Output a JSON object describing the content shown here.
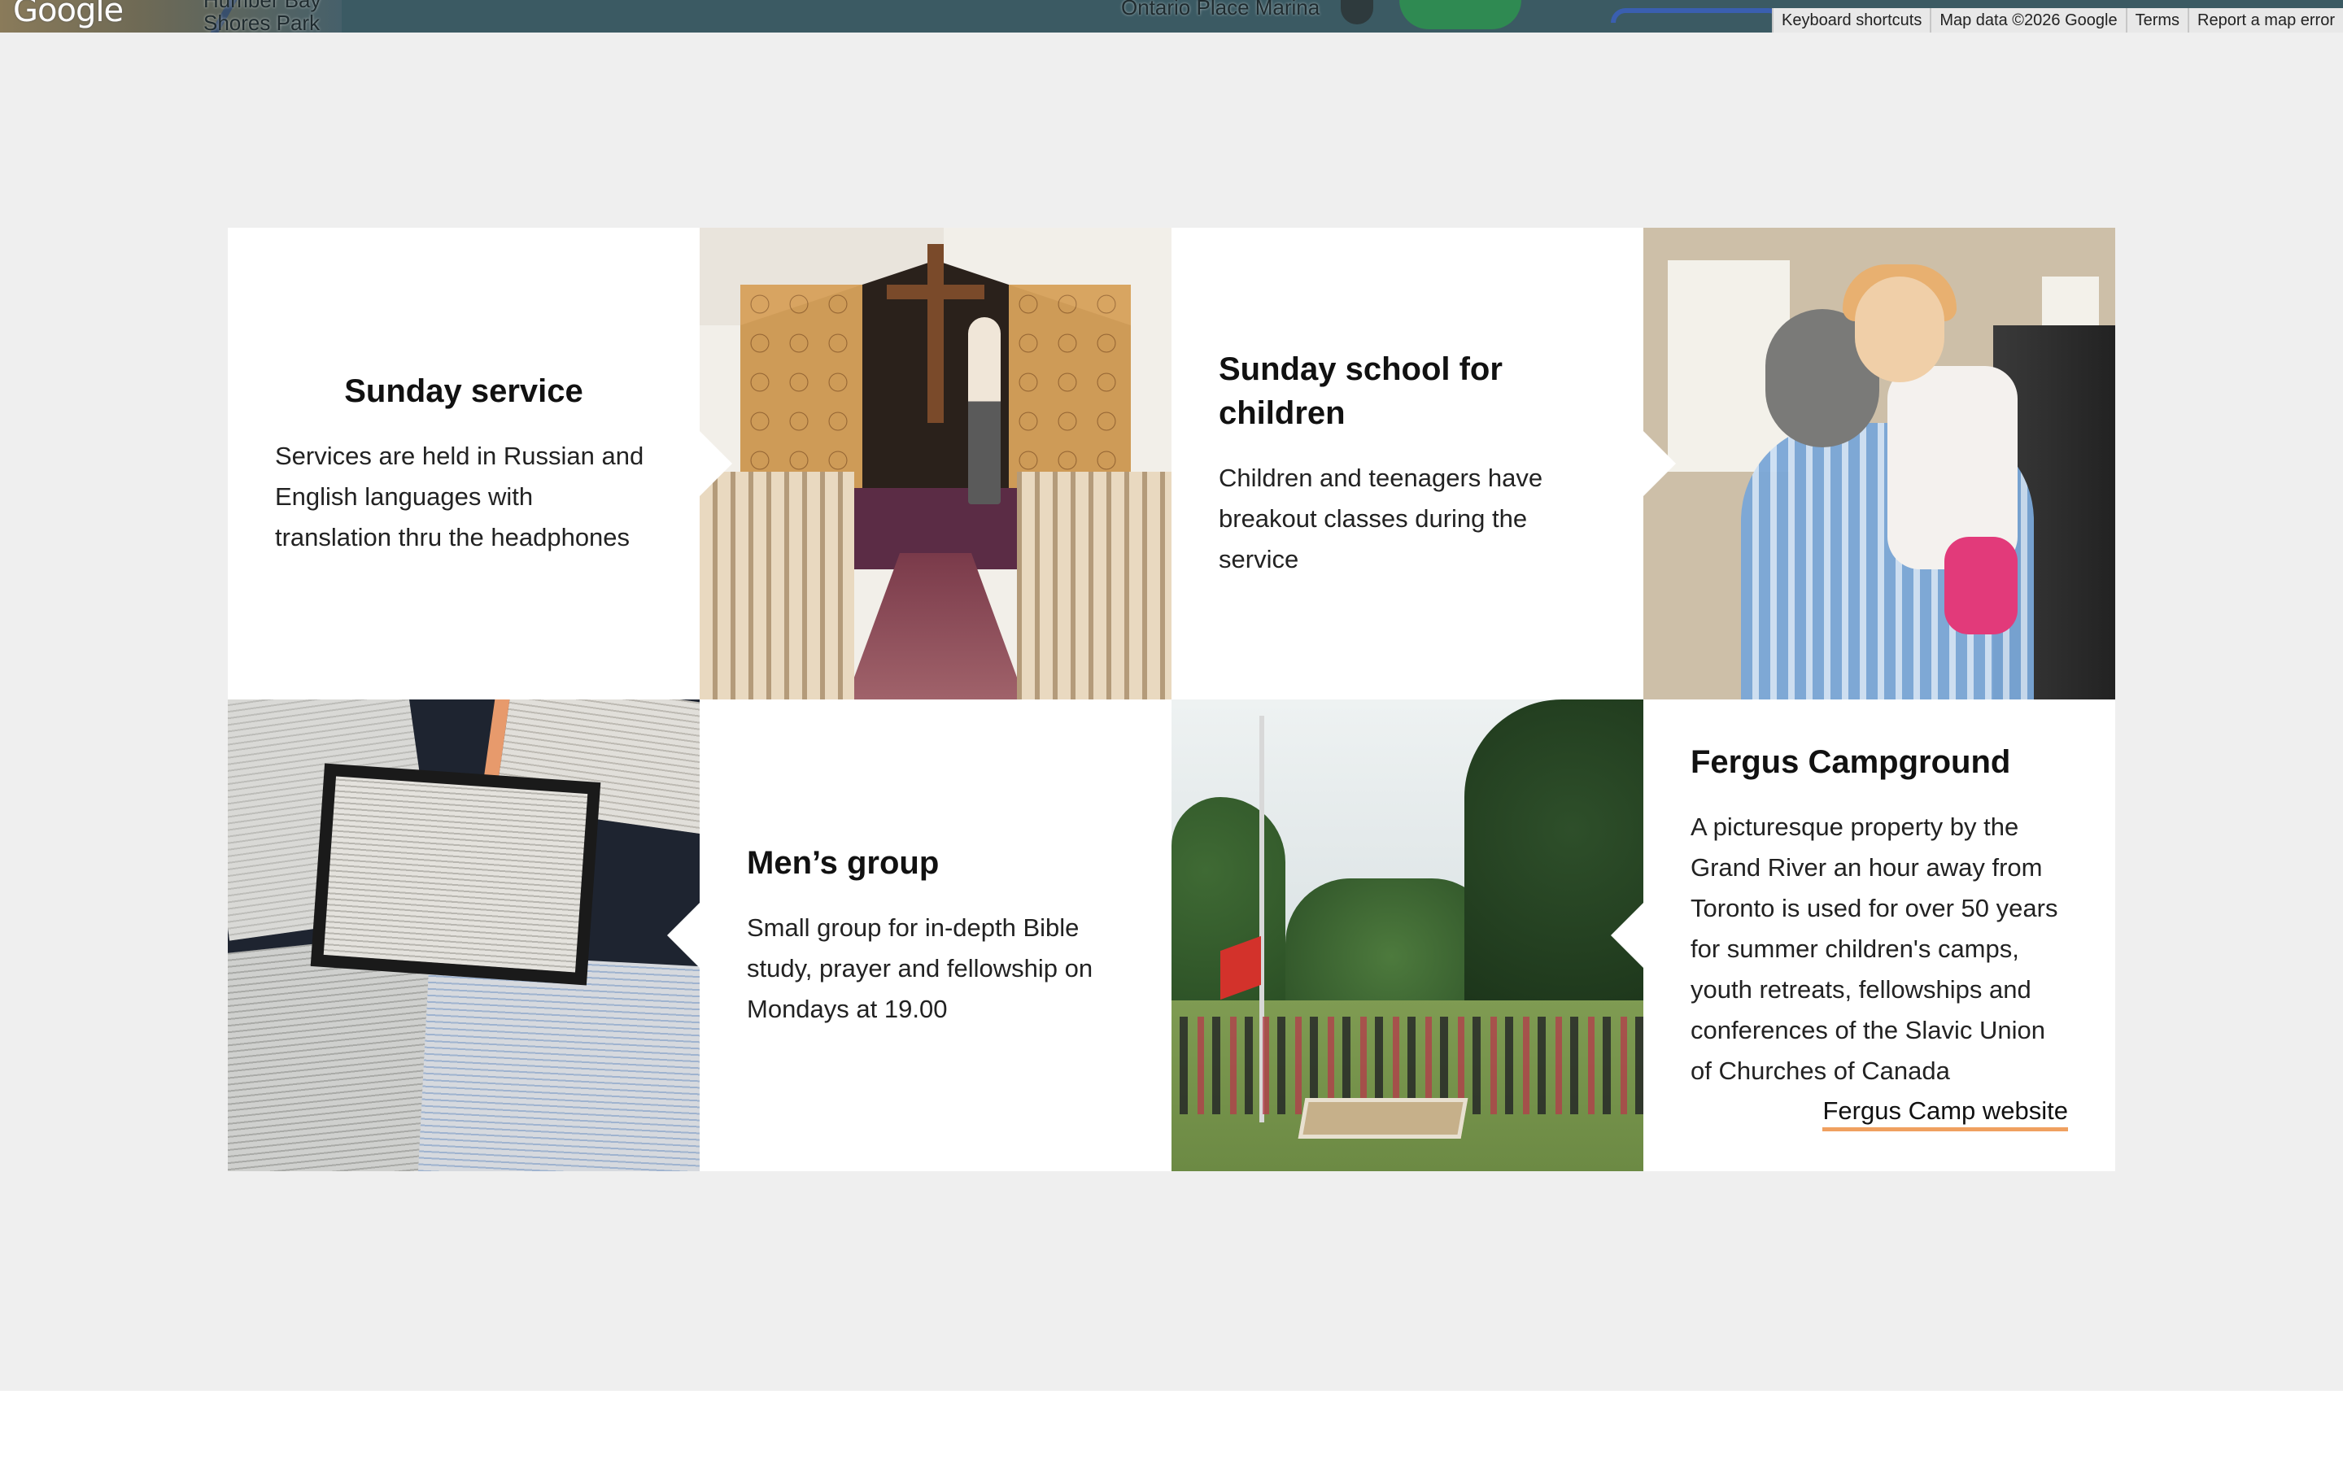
{
  "map": {
    "logo_text": "Google",
    "place_label_1": "Humber Bay\nShores Park",
    "place_label_2": "Ontario Place Marina",
    "attribution": {
      "keyboard_shortcuts": "Keyboard shortcuts",
      "map_data": "Map data ©2026 Google",
      "terms": "Terms",
      "report": "Report a map error"
    }
  },
  "activities": {
    "sunday_service": {
      "title": "Sunday service",
      "description": "Services are held in Russian and English languages with translation thru the headphones"
    },
    "sunday_school": {
      "title": "Sunday school for children",
      "description": "Children and teenagers have breakout classes during the service"
    },
    "mens_group": {
      "title": "Men’s group",
      "description": "Small group for in-depth Bible study, prayer and fellowship on Mondays at 19.00"
    },
    "fergus": {
      "title": "Fergus Campground",
      "description": "A picturesque property by the Grand River an hour away from Toronto is used for over 50 years for summer children's camps, youth retreats, fellowships and conferences of the Slavic Union of Churches of Canada",
      "link_label": "Fergus Camp website"
    }
  },
  "colors": {
    "section_bg": "#efefef",
    "card_bg": "#ffffff",
    "link_underline": "#f0a060"
  }
}
